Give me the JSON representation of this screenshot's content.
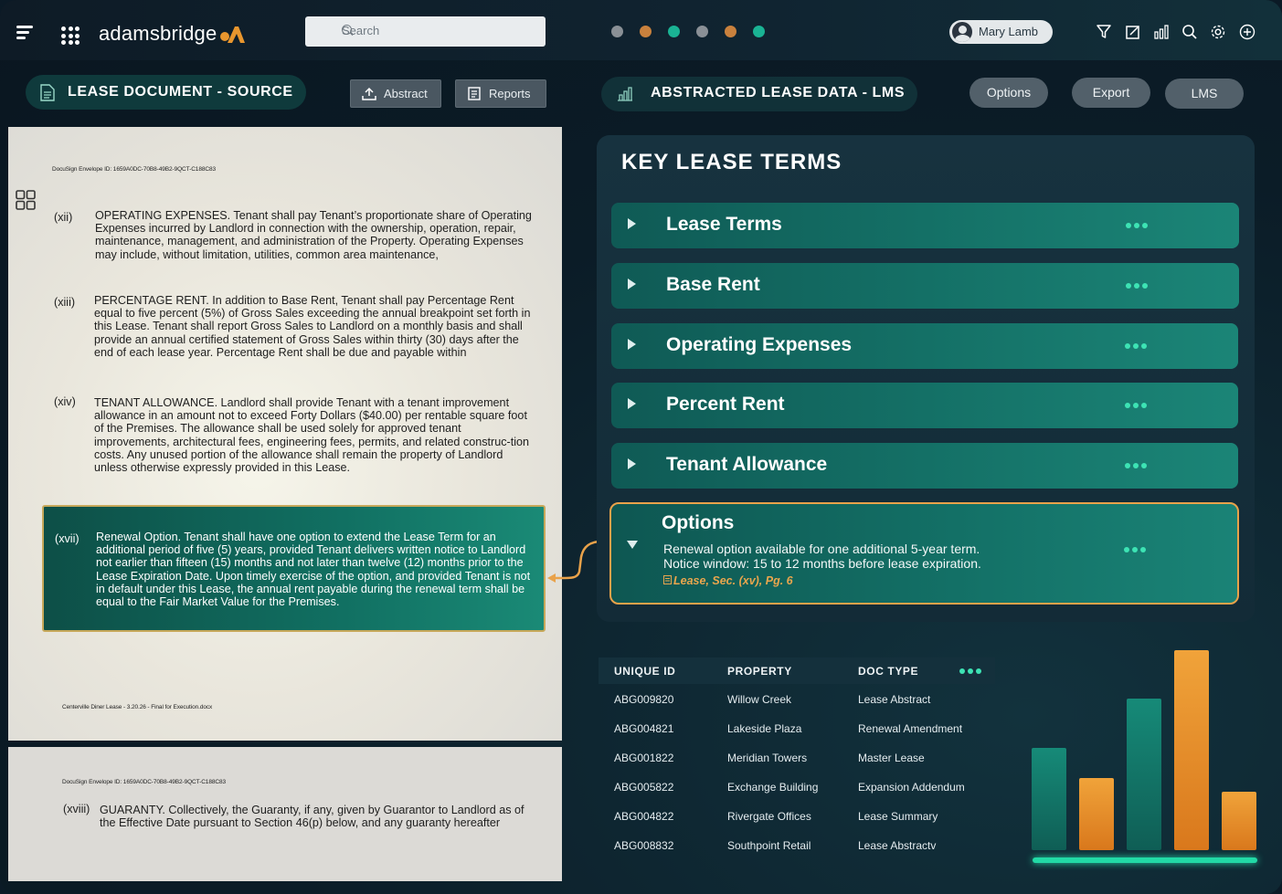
{
  "header": {
    "logo_text": "adamsbridge",
    "search_placeholder": "Search",
    "status_dots": [
      "#8a9096",
      "#c9813d",
      "#1ab394",
      "#8a9096",
      "#c9813d",
      "#1ab394"
    ],
    "user_name": "Mary Lamb",
    "toolbar_icons": [
      "filter-icon",
      "edit-icon",
      "bar-chart-icon",
      "search-icon",
      "settings-icon",
      "add-circle-icon"
    ]
  },
  "left_panel": {
    "title": "LEASE DOCUMENT - SOURCE",
    "abstract_label": "Abstract",
    "reports_label": "Reports",
    "document": {
      "envelope_id": "DocuSign Envelope ID: 1659A0DC-70B8-49B2-9QCT-C188C83",
      "clauses": [
        {
          "num": "(xii)",
          "text": "OPERATING EXPENSES. Tenant shall pay Tenant’s proportionate share of Operating Expenses incurred by Landlord in connection with the ownership, operation, repair, maintenance, management, and administration of the Property. Operating Expenses may include, without limitation, utilities, common area maintenance,"
        },
        {
          "num": "(xiii)",
          "text": "PERCENTAGE RENT. In addition to Base Rent, Tenant shall pay Percentage Rent equal to five percent (5%) of Gross Sales exceeding the annual breakpoint set forth in this Lease. Tenant shall report Gross Sales to Landlord on a monthly basis and shall provide an annual certified statement of Gross Sales within thirty (30) days after the end of each lease year. Percentage Rent shall be due and payable within"
        },
        {
          "num": "(xiv)",
          "text": "TENANT ALLOWANCE. Landlord shall provide Tenant with a tenant improvement allowance in an amount not to exceed Forty Dollars ($40.00) per rentable square foot of the Premises. The allowance shall be used solely for approved tenant improvements, architectural fees, engineering fees, permits, and related construc-tion costs. Any unused portion of the allowance shall remain the property of Landlord unless otherwise expressly provided in this Lease."
        },
        {
          "num": "(xvii)",
          "text": "Renewal Option. Tenant shall have one option to extend the Lease Term for an additional period of five (5) years, provided Tenant delivers written notice to Landlord not earlier than fifteen (15) months and not later than twelve (12) months prior to the Lease Expiration Date. Upon timely exercise of the option, and provided Tenant is not in default under this Lease, the annual rent payable during the renewal term shall be equal to the Fair Market Value for the Premises."
        }
      ],
      "footer": "Centerville Diner Lease - 3.20.26 - Final for Execution.docx",
      "page2_envelope_id": "DocuSign Envelope ID: 1659A0DC-70B8-49B2-9QCT-C188C83",
      "page2_clause": {
        "num": "(xviii)",
        "text": "GUARANTY. Collectively, the Guaranty, if any, given by Guarantor to Landlord as of the Effective Date pursuant to Section 46(p) below, and any guaranty hereafter"
      }
    }
  },
  "right_panel": {
    "title_main": "ABSTRACTED LEASE DATA - ",
    "title_bold": "LMS",
    "options_label": "Options",
    "export_label": "Export",
    "lms_label": "LMS",
    "key_lease_terms": {
      "title": "KEY LEASE TERMS",
      "sections": [
        "Lease Terms",
        "Base Rent",
        "Operating Expenses",
        "Percent Rent",
        "Tenant Allowance"
      ],
      "expanded": {
        "title": "Options",
        "line1": "Renewal option available for one additional 5-year term.",
        "line2": "Notice window: 15 to 12 months before lease expiration.",
        "ref": "Lease, Sec. (xv), Pg. 6"
      }
    },
    "table": {
      "headers": [
        "UNIQUE ID",
        "PROPERTY",
        "DOC TYPE"
      ],
      "rows": [
        [
          "ABG009820",
          "Willow Creek",
          "Lease Abstract"
        ],
        [
          "ABG004821",
          "Lakeside Plaza",
          "Renewal Amendment"
        ],
        [
          "ABG001822",
          "Meridian Towers",
          "Master Lease"
        ],
        [
          "ABG005822",
          "Exchange Building",
          "Expansion Addendum"
        ],
        [
          "ABG004822",
          "Rivergate Offices",
          "Lease Summary"
        ],
        [
          "ABG008832",
          "Southpoint Retail",
          "Lease Abstractv"
        ]
      ]
    }
  },
  "chart_data": {
    "type": "bar",
    "categories": [
      "1",
      "2",
      "3",
      "4",
      "5"
    ],
    "values": [
      0.51,
      0.36,
      0.76,
      1.0,
      0.29
    ],
    "colors": [
      "#137a6c",
      "#e28a27",
      "#137a6c",
      "#e28a27",
      "#e28a27"
    ],
    "title": "",
    "xlabel": "",
    "ylabel": ""
  }
}
